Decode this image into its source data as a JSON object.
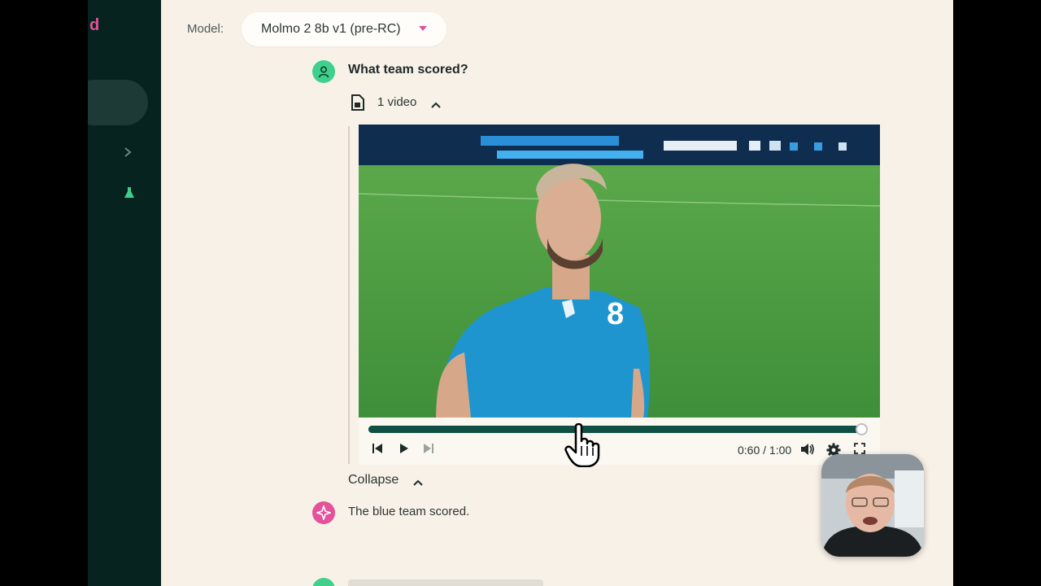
{
  "sidebar": {
    "logo_fragment": "d",
    "icons": [
      "chevron-right-icon",
      "flask-icon"
    ]
  },
  "header": {
    "model_label": "Model:",
    "model_value": "Molmo 2 8b v1 (pre-RC)"
  },
  "chat": {
    "question": "What team scored?",
    "attachment_label": "1 video",
    "collapse_label": "Collapse",
    "answer": "The blue team scored."
  },
  "player": {
    "time_display": "0:60 / 1:00",
    "progress_fraction": 0.99
  },
  "colors": {
    "sidebar_bg": "#06231f",
    "main_bg": "#f8f1e8",
    "accent_pink": "#e3529a",
    "accent_green": "#3fd08b",
    "progress": "#0f4f44"
  }
}
